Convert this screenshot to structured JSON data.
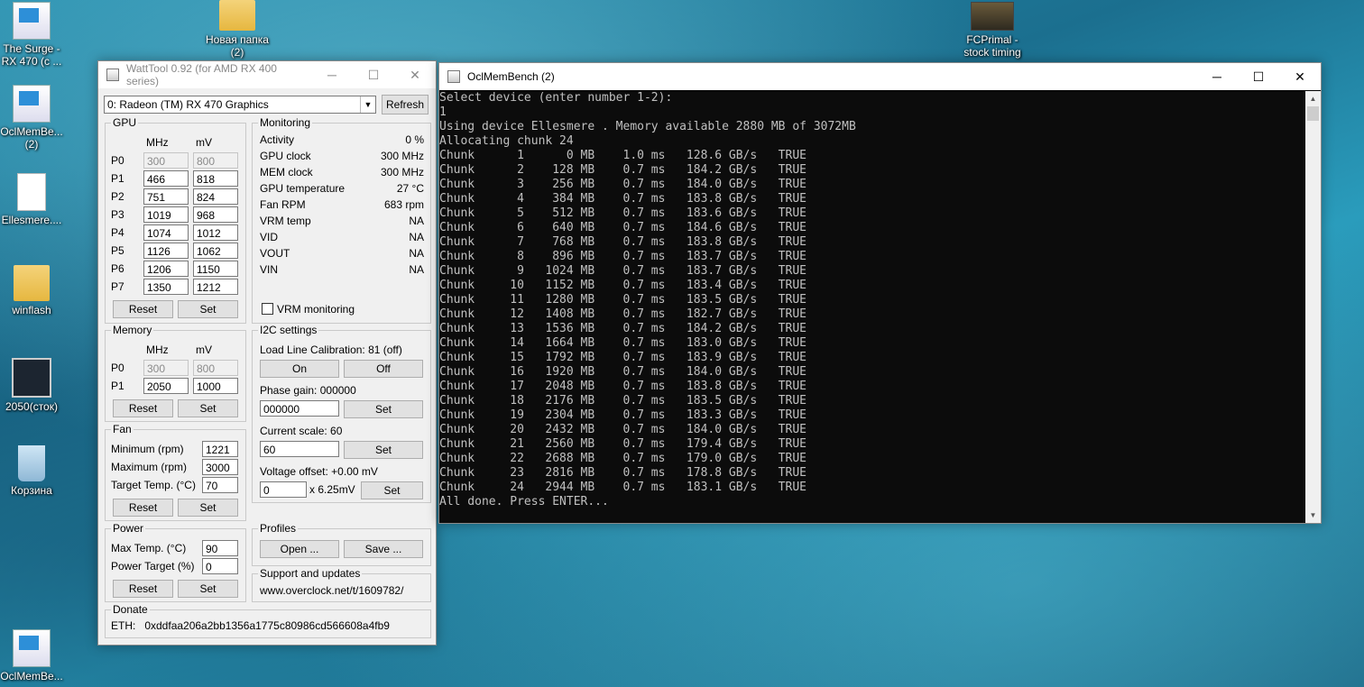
{
  "desktop": {
    "icons": [
      {
        "label": "The Surge -\nRX 470 (с ...",
        "icon": "app-shortcut-icon"
      },
      {
        "label": "OclMemBe...\n(2)",
        "icon": "app-shortcut-icon"
      },
      {
        "label": "Ellesmere....",
        "icon": "document-icon"
      },
      {
        "label": "winflash",
        "icon": "folder-icon"
      },
      {
        "label": "2050(сток)",
        "icon": "monitor-icon"
      },
      {
        "label": "Корзина",
        "icon": "recycle-bin-icon"
      },
      {
        "label": "OclMemBe...",
        "icon": "app-shortcut-icon"
      },
      {
        "label": "Новая папка\n(2)",
        "icon": "folder-icon"
      },
      {
        "label": "FCPrimal -\nstock timing",
        "icon": "game-shortcut-icon"
      }
    ]
  },
  "wattool": {
    "title": "WattTool 0.92 (for AMD RX 400 series)",
    "device": "0: Radeon (TM) RX 470 Graphics",
    "refresh_label": "Refresh",
    "gpu": {
      "title": "GPU",
      "col_mhz": "MHz",
      "col_mv": "mV",
      "states": [
        {
          "p": "P0",
          "mhz": "300",
          "mv": "800"
        },
        {
          "p": "P1",
          "mhz": "466",
          "mv": "818"
        },
        {
          "p": "P2",
          "mhz": "751",
          "mv": "824"
        },
        {
          "p": "P3",
          "mhz": "1019",
          "mv": "968"
        },
        {
          "p": "P4",
          "mhz": "1074",
          "mv": "1012"
        },
        {
          "p": "P5",
          "mhz": "1126",
          "mv": "1062"
        },
        {
          "p": "P6",
          "mhz": "1206",
          "mv": "1150"
        },
        {
          "p": "P7",
          "mhz": "1350",
          "mv": "1212"
        }
      ],
      "reset_label": "Reset",
      "set_label": "Set"
    },
    "monitoring": {
      "title": "Monitoring",
      "rows": [
        {
          "label": "Activity",
          "value": "0 %"
        },
        {
          "label": "GPU clock",
          "value": "300 MHz"
        },
        {
          "label": "MEM clock",
          "value": "300 MHz"
        },
        {
          "label": "GPU temperature",
          "value": "27 °C"
        },
        {
          "label": "Fan RPM",
          "value": "683 rpm"
        },
        {
          "label": "VRM temp",
          "value": "NA"
        },
        {
          "label": "VID",
          "value": "NA"
        },
        {
          "label": "VOUT",
          "value": "NA"
        },
        {
          "label": "VIN",
          "value": "NA"
        }
      ],
      "vrm_checkbox_label": "VRM monitoring"
    },
    "memory": {
      "title": "Memory",
      "col_mhz": "MHz",
      "col_mv": "mV",
      "states": [
        {
          "p": "P0",
          "mhz": "300",
          "mv": "800"
        },
        {
          "p": "P1",
          "mhz": "2050",
          "mv": "1000"
        }
      ],
      "reset_label": "Reset",
      "set_label": "Set"
    },
    "i2c": {
      "title": "I2C settings",
      "llc_label": "Load Line Calibration: 81 (off)",
      "on_label": "On",
      "off_label": "Off",
      "phase_gain_label": "Phase gain: 000000",
      "phase_gain_value": "000000",
      "current_scale_label": "Current scale: 60",
      "current_scale_value": "60",
      "voltage_offset_label": "Voltage offset: +0.00 mV",
      "voltage_offset_value": "0",
      "voltage_unit": "x 6.25mV",
      "set_label": "Set"
    },
    "fan": {
      "title": "Fan",
      "rows": [
        {
          "label": "Minimum (rpm)",
          "value": "1221"
        },
        {
          "label": "Maximum (rpm)",
          "value": "3000"
        },
        {
          "label": "Target Temp. (°C)",
          "value": "70"
        }
      ],
      "reset_label": "Reset",
      "set_label": "Set"
    },
    "power": {
      "title": "Power",
      "rows": [
        {
          "label": "Max Temp. (°C)",
          "value": "90"
        },
        {
          "label": "Power Target (%)",
          "value": "0"
        }
      ],
      "reset_label": "Reset",
      "set_label": "Set"
    },
    "profiles": {
      "title": "Profiles",
      "open_label": "Open ...",
      "save_label": "Save ..."
    },
    "support": {
      "title": "Support and updates",
      "url": "www.overclock.net/t/1609782/"
    },
    "donate": {
      "title": "Donate",
      "eth": "ETH:   0xddfaa206a2bb1356a1775c80986cd566608a4fb9"
    }
  },
  "console": {
    "title": "OclMemBench (2)",
    "lines": [
      "Select device (enter number 1-2):",
      "1",
      "Using device Ellesmere . Memory available 2880 MB of 3072MB",
      "Allocating chunk 24",
      "Chunk      1      0 MB    1.0 ms   128.6 GB/s   TRUE",
      "Chunk      2    128 MB    0.7 ms   184.2 GB/s   TRUE",
      "Chunk      3    256 MB    0.7 ms   184.0 GB/s   TRUE",
      "Chunk      4    384 MB    0.7 ms   183.8 GB/s   TRUE",
      "Chunk      5    512 MB    0.7 ms   183.6 GB/s   TRUE",
      "Chunk      6    640 MB    0.7 ms   184.6 GB/s   TRUE",
      "Chunk      7    768 MB    0.7 ms   183.8 GB/s   TRUE",
      "Chunk      8    896 MB    0.7 ms   183.7 GB/s   TRUE",
      "Chunk      9   1024 MB    0.7 ms   183.7 GB/s   TRUE",
      "Chunk     10   1152 MB    0.7 ms   183.4 GB/s   TRUE",
      "Chunk     11   1280 MB    0.7 ms   183.5 GB/s   TRUE",
      "Chunk     12   1408 MB    0.7 ms   182.7 GB/s   TRUE",
      "Chunk     13   1536 MB    0.7 ms   184.2 GB/s   TRUE",
      "Chunk     14   1664 MB    0.7 ms   183.0 GB/s   TRUE",
      "Chunk     15   1792 MB    0.7 ms   183.9 GB/s   TRUE",
      "Chunk     16   1920 MB    0.7 ms   184.0 GB/s   TRUE",
      "Chunk     17   2048 MB    0.7 ms   183.8 GB/s   TRUE",
      "Chunk     18   2176 MB    0.7 ms   183.5 GB/s   TRUE",
      "Chunk     19   2304 MB    0.7 ms   183.3 GB/s   TRUE",
      "Chunk     20   2432 MB    0.7 ms   184.0 GB/s   TRUE",
      "Chunk     21   2560 MB    0.7 ms   179.4 GB/s   TRUE",
      "Chunk     22   2688 MB    0.7 ms   179.0 GB/s   TRUE",
      "Chunk     23   2816 MB    0.7 ms   178.8 GB/s   TRUE",
      "Chunk     24   2944 MB    0.7 ms   183.1 GB/s   TRUE",
      "All done. Press ENTER..."
    ]
  }
}
